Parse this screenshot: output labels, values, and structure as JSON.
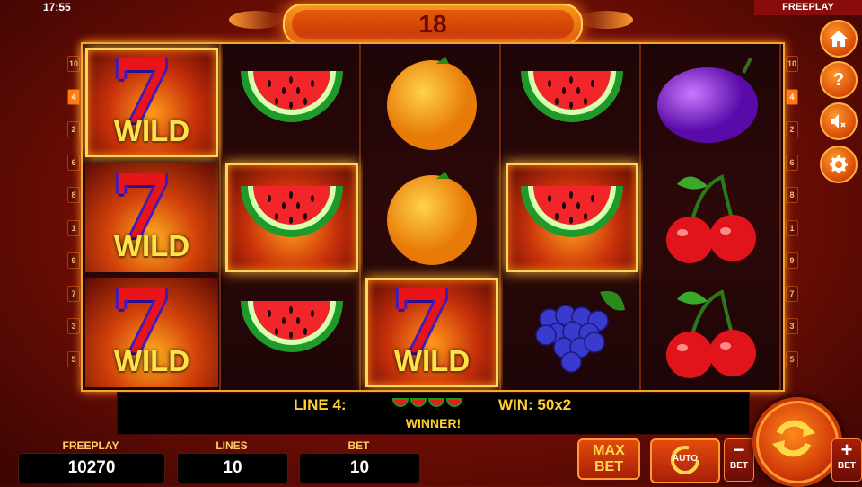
{
  "status": {
    "time": "17:55",
    "mode": "FREEPLAY"
  },
  "title_counter": "18",
  "left_line_numbers": [
    "10",
    "4",
    "2",
    "6",
    "8",
    "1",
    "9",
    "7",
    "3",
    "5"
  ],
  "right_line_numbers": [
    "10",
    "4",
    "2",
    "6",
    "8",
    "1",
    "9",
    "7",
    "3",
    "5"
  ],
  "highlighted_line": "4",
  "reels": [
    [
      {
        "symbol": "seven",
        "label": "WILD",
        "win": true
      },
      {
        "symbol": "seven",
        "label": "WILD",
        "win": false
      },
      {
        "symbol": "seven",
        "label": "WILD",
        "win": false
      }
    ],
    [
      {
        "symbol": "watermelon",
        "win": false
      },
      {
        "symbol": "watermelon",
        "win": true
      },
      {
        "symbol": "watermelon",
        "win": false
      }
    ],
    [
      {
        "symbol": "orange",
        "win": false
      },
      {
        "symbol": "orange",
        "win": false
      },
      {
        "symbol": "seven",
        "label": "WILD",
        "win": true
      }
    ],
    [
      {
        "symbol": "watermelon",
        "win": false
      },
      {
        "symbol": "watermelon",
        "win": true
      },
      {
        "symbol": "grapes",
        "win": false
      }
    ],
    [
      {
        "symbol": "plum",
        "win": false
      },
      {
        "symbol": "cherries",
        "win": false
      },
      {
        "symbol": "cherries",
        "win": false
      }
    ]
  ],
  "side_buttons": [
    {
      "name": "home-icon"
    },
    {
      "name": "help-icon"
    },
    {
      "name": "sound-muted-icon"
    },
    {
      "name": "settings-icon"
    }
  ],
  "info": {
    "line": "LINE 4:",
    "win": "WIN: 50x2",
    "winner": "WINNER!"
  },
  "stats": {
    "freeplay_label": "FREEPLAY",
    "freeplay_value": "10270",
    "lines_label": "LINES",
    "lines_value": "10",
    "bet_label": "BET",
    "bet_value": "10"
  },
  "controls": {
    "max": "MAX",
    "bet": "BET",
    "auto": "AUTO",
    "minus_bet": "BET",
    "plus_bet": "BET"
  }
}
